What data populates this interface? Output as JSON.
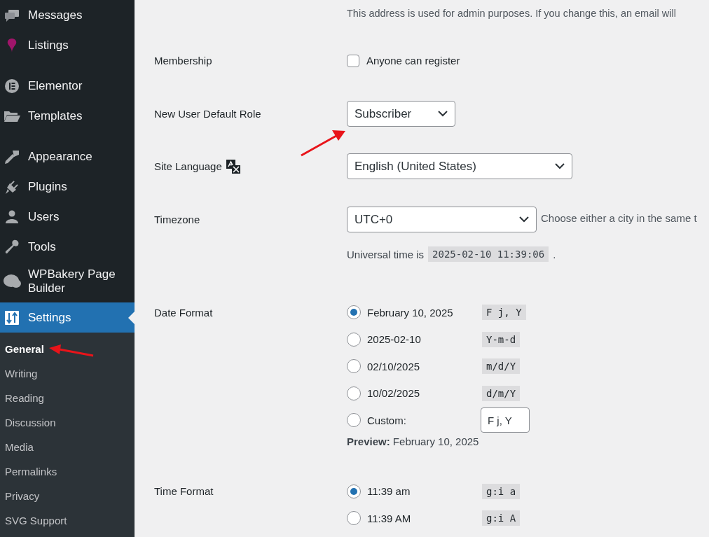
{
  "sidebar": {
    "items": [
      {
        "kind": "menu",
        "label": "Messages",
        "selected": false
      },
      {
        "kind": "menu",
        "label": "Listings",
        "selected": false
      },
      {
        "kind": "separator"
      },
      {
        "kind": "menu",
        "label": "Elementor",
        "selected": false
      },
      {
        "kind": "menu",
        "label": "Templates",
        "selected": false
      },
      {
        "kind": "separator"
      },
      {
        "kind": "menu",
        "label": "Appearance",
        "selected": false
      },
      {
        "kind": "menu",
        "label": "Plugins",
        "selected": false
      },
      {
        "kind": "menu",
        "label": "Users",
        "selected": false
      },
      {
        "kind": "menu",
        "label": "Tools",
        "selected": false
      },
      {
        "kind": "menu",
        "label": "WPBakery Page Builder",
        "selected": false
      },
      {
        "kind": "menu",
        "label": "Settings",
        "selected": true
      }
    ],
    "submenu": [
      {
        "label": "General",
        "selected": true
      },
      {
        "label": "Writing",
        "selected": false
      },
      {
        "label": "Reading",
        "selected": false
      },
      {
        "label": "Discussion",
        "selected": false
      },
      {
        "label": "Media",
        "selected": false
      },
      {
        "label": "Permalinks",
        "selected": false
      },
      {
        "label": "Privacy",
        "selected": false
      },
      {
        "label": "SVG Support",
        "selected": false
      }
    ]
  },
  "admin_email_help": "This address is used for admin purposes. If you change this, an email will",
  "fields": [
    {
      "kind": "checkbox",
      "label": "Membership",
      "option": "Anyone can register",
      "checked": false
    },
    {
      "kind": "select",
      "label": "New User Default Role",
      "value": "Subscriber"
    },
    {
      "kind": "language_select",
      "label": "Site Language",
      "value": "English (United States)"
    },
    {
      "kind": "timezone_select",
      "label": "Timezone",
      "value": "UTC+0",
      "hint": "Choose either a city in the same t",
      "universal_time_label": "Universal time is",
      "universal_time": "2025-02-10 11:39:06",
      "universal_time_end": "."
    },
    {
      "kind": "radio_group",
      "label": "Date Format",
      "options": [
        {
          "label": "February 10, 2025",
          "code": "F j, Y",
          "selected": true
        },
        {
          "label": "2025-02-10",
          "code": "Y-m-d",
          "selected": false
        },
        {
          "label": "02/10/2025",
          "code": "m/d/Y",
          "selected": false
        },
        {
          "label": "10/02/2025",
          "code": "d/m/Y",
          "selected": false
        },
        {
          "label": "Custom:",
          "custom_value": "F j, Y",
          "selected": false
        }
      ],
      "preview": "**Preview:** February 10, 2025"
    },
    {
      "kind": "radio_group",
      "label": "Time Format",
      "options": [
        {
          "label": "11:39 am",
          "code": "g:i a",
          "selected": true
        },
        {
          "label": "11:39 AM",
          "code": "g:i A",
          "selected": false
        }
      ]
    }
  ]
}
